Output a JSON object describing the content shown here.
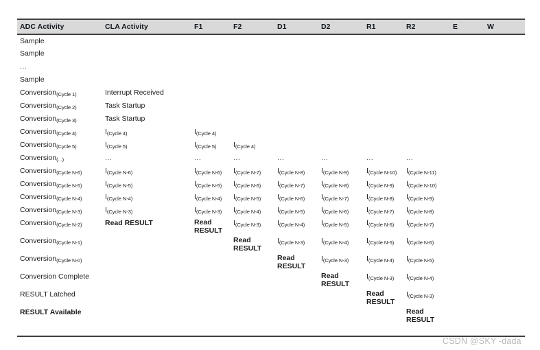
{
  "table": {
    "columns": [
      {
        "key": "adc",
        "label": "ADC Activity",
        "width": 128
      },
      {
        "key": "cla",
        "label": "CLA Activity",
        "width": 130
      },
      {
        "key": "f1",
        "label": "F1",
        "width": 57
      },
      {
        "key": "f2",
        "label": "F2",
        "width": 64
      },
      {
        "key": "d1",
        "label": "D1",
        "width": 64
      },
      {
        "key": "d2",
        "label": "D2",
        "width": 66
      },
      {
        "key": "r1",
        "label": "R1",
        "width": 58
      },
      {
        "key": "r2",
        "label": "R2",
        "width": 68
      },
      {
        "key": "e",
        "label": "E",
        "width": 50
      },
      {
        "key": "w",
        "label": "W",
        "width": 55
      }
    ],
    "rows": [
      {
        "tall": false,
        "cells": [
          {
            "type": "text",
            "text": "Sample"
          },
          {
            "type": "empty"
          },
          {
            "type": "empty"
          },
          {
            "type": "empty"
          },
          {
            "type": "empty"
          },
          {
            "type": "empty"
          },
          {
            "type": "empty"
          },
          {
            "type": "empty"
          },
          {
            "type": "empty"
          },
          {
            "type": "empty"
          }
        ]
      },
      {
        "tall": false,
        "cells": [
          {
            "type": "text",
            "text": "Sample"
          },
          {
            "type": "empty"
          },
          {
            "type": "empty"
          },
          {
            "type": "empty"
          },
          {
            "type": "empty"
          },
          {
            "type": "empty"
          },
          {
            "type": "empty"
          },
          {
            "type": "empty"
          },
          {
            "type": "empty"
          },
          {
            "type": "empty"
          }
        ]
      },
      {
        "tall": false,
        "cells": [
          {
            "type": "dots",
            "text": "..."
          },
          {
            "type": "empty"
          },
          {
            "type": "empty"
          },
          {
            "type": "empty"
          },
          {
            "type": "empty"
          },
          {
            "type": "empty"
          },
          {
            "type": "empty"
          },
          {
            "type": "empty"
          },
          {
            "type": "empty"
          },
          {
            "type": "empty"
          }
        ]
      },
      {
        "tall": false,
        "cells": [
          {
            "type": "text",
            "text": "Sample"
          },
          {
            "type": "empty"
          },
          {
            "type": "empty"
          },
          {
            "type": "empty"
          },
          {
            "type": "empty"
          },
          {
            "type": "empty"
          },
          {
            "type": "empty"
          },
          {
            "type": "empty"
          },
          {
            "type": "empty"
          },
          {
            "type": "empty"
          }
        ]
      },
      {
        "tall": false,
        "cells": [
          {
            "type": "sub",
            "base": "Conversion",
            "subscript": "(Cycle 1)"
          },
          {
            "type": "text",
            "text": "Interrupt Received"
          },
          {
            "type": "empty"
          },
          {
            "type": "empty"
          },
          {
            "type": "empty"
          },
          {
            "type": "empty"
          },
          {
            "type": "empty"
          },
          {
            "type": "empty"
          },
          {
            "type": "empty"
          },
          {
            "type": "empty"
          }
        ]
      },
      {
        "tall": false,
        "cells": [
          {
            "type": "sub",
            "base": "Conversion",
            "subscript": "(Cycle 2)"
          },
          {
            "type": "text",
            "text": "Task Startup"
          },
          {
            "type": "empty"
          },
          {
            "type": "empty"
          },
          {
            "type": "empty"
          },
          {
            "type": "empty"
          },
          {
            "type": "empty"
          },
          {
            "type": "empty"
          },
          {
            "type": "empty"
          },
          {
            "type": "empty"
          }
        ]
      },
      {
        "tall": false,
        "cells": [
          {
            "type": "sub",
            "base": "Conversion",
            "subscript": "(Cycle 3)"
          },
          {
            "type": "text",
            "text": "Task Startup"
          },
          {
            "type": "empty"
          },
          {
            "type": "empty"
          },
          {
            "type": "empty"
          },
          {
            "type": "empty"
          },
          {
            "type": "empty"
          },
          {
            "type": "empty"
          },
          {
            "type": "empty"
          },
          {
            "type": "empty"
          }
        ]
      },
      {
        "tall": false,
        "cells": [
          {
            "type": "sub",
            "base": "Conversion",
            "subscript": "(Cycle 4)"
          },
          {
            "type": "sub",
            "base": "I",
            "subscript": "(Cycle 4)"
          },
          {
            "type": "sub",
            "base": "I",
            "subscript": "(Cycle 4)"
          },
          {
            "type": "empty"
          },
          {
            "type": "empty"
          },
          {
            "type": "empty"
          },
          {
            "type": "empty"
          },
          {
            "type": "empty"
          },
          {
            "type": "empty"
          },
          {
            "type": "empty"
          }
        ]
      },
      {
        "tall": false,
        "cells": [
          {
            "type": "sub",
            "base": "Conversion",
            "subscript": "(Cycle 5)"
          },
          {
            "type": "sub",
            "base": "I",
            "subscript": "(Cycle 5)"
          },
          {
            "type": "sub",
            "base": "I",
            "subscript": "(Cycle 5)"
          },
          {
            "type": "sub",
            "base": "I",
            "subscript": "(Cycle 4)"
          },
          {
            "type": "empty"
          },
          {
            "type": "empty"
          },
          {
            "type": "empty"
          },
          {
            "type": "empty"
          },
          {
            "type": "empty"
          },
          {
            "type": "empty"
          }
        ]
      },
      {
        "tall": false,
        "cells": [
          {
            "type": "sub",
            "base": "Conversion",
            "subscript": "(...)"
          },
          {
            "type": "dots",
            "text": "..."
          },
          {
            "type": "dots",
            "text": "..."
          },
          {
            "type": "dots",
            "text": "..."
          },
          {
            "type": "dots",
            "text": "..."
          },
          {
            "type": "dots",
            "text": "..."
          },
          {
            "type": "dots",
            "text": "..."
          },
          {
            "type": "dots",
            "text": "..."
          },
          {
            "type": "empty"
          },
          {
            "type": "empty"
          }
        ]
      },
      {
        "tall": false,
        "cells": [
          {
            "type": "sub",
            "base": "Conversion",
            "subscript": "(Cycle N-6)"
          },
          {
            "type": "sub",
            "base": "I",
            "subscript": "(Cycle N-6)"
          },
          {
            "type": "sub",
            "base": "I",
            "subscript": "(Cycle N-6)"
          },
          {
            "type": "sub",
            "base": "I",
            "subscript": "(Cycle N-7)"
          },
          {
            "type": "sub",
            "base": "I",
            "subscript": "(Cycle N-8)"
          },
          {
            "type": "sub",
            "base": "I",
            "subscript": "(Cycle N-9)"
          },
          {
            "type": "sub",
            "base": "I",
            "subscript": "(Cycle N-10)"
          },
          {
            "type": "sub",
            "base": "I",
            "subscript": "(Cycle N-11)"
          },
          {
            "type": "empty"
          },
          {
            "type": "empty"
          }
        ]
      },
      {
        "tall": false,
        "cells": [
          {
            "type": "sub",
            "base": "Conversion",
            "subscript": "(Cycle N-5)"
          },
          {
            "type": "sub",
            "base": "I",
            "subscript": "(Cycle N-5)"
          },
          {
            "type": "sub",
            "base": "I",
            "subscript": "(Cycle N-5)"
          },
          {
            "type": "sub",
            "base": "I",
            "subscript": "(Cycle N-6)"
          },
          {
            "type": "sub",
            "base": "I",
            "subscript": "(Cycle N-7)"
          },
          {
            "type": "sub",
            "base": "I",
            "subscript": "(Cycle N-8)"
          },
          {
            "type": "sub",
            "base": "I",
            "subscript": "(Cycle N-9)"
          },
          {
            "type": "sub",
            "base": "I",
            "subscript": "(Cycle N-10)"
          },
          {
            "type": "empty"
          },
          {
            "type": "empty"
          }
        ]
      },
      {
        "tall": false,
        "cells": [
          {
            "type": "sub",
            "base": "Conversion",
            "subscript": "(Cycle N-4)"
          },
          {
            "type": "sub",
            "base": "I",
            "subscript": "(Cycle N-4)"
          },
          {
            "type": "sub",
            "base": "I",
            "subscript": "(Cycle N-4)"
          },
          {
            "type": "sub",
            "base": "I",
            "subscript": "(Cycle N-5)"
          },
          {
            "type": "sub",
            "base": "I",
            "subscript": "(Cycle N-6)"
          },
          {
            "type": "sub",
            "base": "I",
            "subscript": "(Cycle N-7)"
          },
          {
            "type": "sub",
            "base": "I",
            "subscript": "(Cycle N-8)"
          },
          {
            "type": "sub",
            "base": "I",
            "subscript": "(Cycle N-9)"
          },
          {
            "type": "empty"
          },
          {
            "type": "empty"
          }
        ]
      },
      {
        "tall": false,
        "cells": [
          {
            "type": "sub",
            "base": "Conversion",
            "subscript": "(Cycle N-3)"
          },
          {
            "type": "sub",
            "base": "I",
            "subscript": "(Cycle N-3)"
          },
          {
            "type": "sub",
            "base": "I",
            "subscript": "(Cycle N-3)"
          },
          {
            "type": "sub",
            "base": "I",
            "subscript": "(Cycle N-4)"
          },
          {
            "type": "sub",
            "base": "I",
            "subscript": "(Cycle N-5)"
          },
          {
            "type": "sub",
            "base": "I",
            "subscript": "(Cycle N-6)"
          },
          {
            "type": "sub",
            "base": "I",
            "subscript": "(Cycle N-7)"
          },
          {
            "type": "sub",
            "base": "I",
            "subscript": "(Cycle N-8)"
          },
          {
            "type": "empty"
          },
          {
            "type": "empty"
          }
        ]
      },
      {
        "tall": true,
        "cells": [
          {
            "type": "sub",
            "base": "Conversion",
            "subscript": "(Cycle N-2)"
          },
          {
            "type": "bold",
            "text": "Read RESULT"
          },
          {
            "type": "bold2",
            "line1": "Read",
            "line2": "RESULT"
          },
          {
            "type": "sub",
            "base": "I",
            "subscript": "(Cycle N-3)"
          },
          {
            "type": "sub",
            "base": "I",
            "subscript": "(Cycle N-4)"
          },
          {
            "type": "sub",
            "base": "I",
            "subscript": "(Cycle N-5)"
          },
          {
            "type": "sub",
            "base": "I",
            "subscript": "(Cycle N-6)"
          },
          {
            "type": "sub",
            "base": "I",
            "subscript": "(Cycle N-7)"
          },
          {
            "type": "empty"
          },
          {
            "type": "empty"
          }
        ]
      },
      {
        "tall": true,
        "cells": [
          {
            "type": "sub",
            "base": "Conversion",
            "subscript": "(Cycle N-1)"
          },
          {
            "type": "empty"
          },
          {
            "type": "empty"
          },
          {
            "type": "bold2",
            "line1": "Read",
            "line2": "RESULT"
          },
          {
            "type": "sub",
            "base": "I",
            "subscript": "(Cycle N-3)"
          },
          {
            "type": "sub",
            "base": "I",
            "subscript": "(Cycle N-4)"
          },
          {
            "type": "sub",
            "base": "I",
            "subscript": "(Cycle N-5)"
          },
          {
            "type": "sub",
            "base": "I",
            "subscript": "(Cycle N-6)"
          },
          {
            "type": "empty"
          },
          {
            "type": "empty"
          }
        ]
      },
      {
        "tall": true,
        "cells": [
          {
            "type": "sub",
            "base": "Conversion",
            "subscript": "(Cycle N-0)"
          },
          {
            "type": "empty"
          },
          {
            "type": "empty"
          },
          {
            "type": "empty"
          },
          {
            "type": "bold2",
            "line1": "Read",
            "line2": "RESULT"
          },
          {
            "type": "sub",
            "base": "I",
            "subscript": "(Cycle N-3)"
          },
          {
            "type": "sub",
            "base": "I",
            "subscript": "(Cycle N-4)"
          },
          {
            "type": "sub",
            "base": "I",
            "subscript": "(Cycle N-5)"
          },
          {
            "type": "empty"
          },
          {
            "type": "empty"
          }
        ]
      },
      {
        "tall": true,
        "cells": [
          {
            "type": "text",
            "text": "Conversion Complete"
          },
          {
            "type": "empty"
          },
          {
            "type": "empty"
          },
          {
            "type": "empty"
          },
          {
            "type": "empty"
          },
          {
            "type": "bold2",
            "line1": "Read",
            "line2": "RESULT"
          },
          {
            "type": "sub",
            "base": "I",
            "subscript": "(Cycle N-3)"
          },
          {
            "type": "sub",
            "base": "I",
            "subscript": "(Cycle N-4)"
          },
          {
            "type": "empty"
          },
          {
            "type": "empty"
          }
        ]
      },
      {
        "tall": true,
        "cells": [
          {
            "type": "text",
            "text": "RESULT Latched"
          },
          {
            "type": "empty"
          },
          {
            "type": "empty"
          },
          {
            "type": "empty"
          },
          {
            "type": "empty"
          },
          {
            "type": "empty"
          },
          {
            "type": "bold2",
            "line1": "Read",
            "line2": "RESULT"
          },
          {
            "type": "sub",
            "base": "I",
            "subscript": "(Cycle N-3)"
          },
          {
            "type": "empty"
          },
          {
            "type": "empty"
          }
        ]
      },
      {
        "tall": true,
        "cells": [
          {
            "type": "bold",
            "text": "RESULT Available"
          },
          {
            "type": "empty"
          },
          {
            "type": "empty"
          },
          {
            "type": "empty"
          },
          {
            "type": "empty"
          },
          {
            "type": "empty"
          },
          {
            "type": "empty"
          },
          {
            "type": "bold2",
            "line1": "Read",
            "line2": "RESULT"
          },
          {
            "type": "empty"
          },
          {
            "type": "empty"
          }
        ]
      }
    ]
  },
  "watermark": {
    "text": "CSDN @SKY -dada"
  },
  "colors": {
    "header_bg": "#d9d9d9",
    "rule": "#3f3f3f",
    "text": "#1b1b1b",
    "watermark": "#b9b9b9"
  }
}
